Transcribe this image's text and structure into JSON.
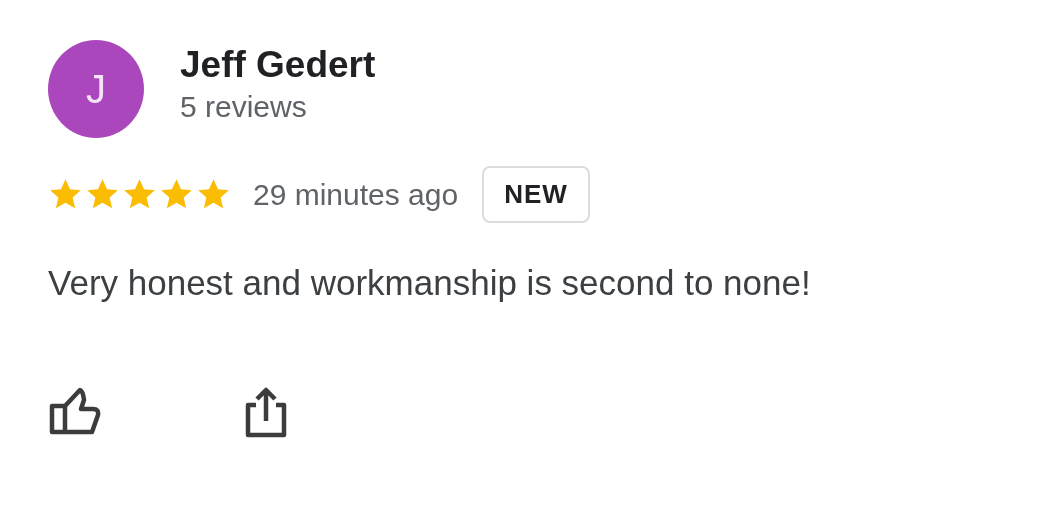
{
  "review": {
    "avatar_letter": "J",
    "author": "Jeff Gedert",
    "review_count": "5 reviews",
    "stars": 5,
    "time": "29 minutes ago",
    "badge": "NEW",
    "text": "Very honest and workmanship is second to none!"
  }
}
